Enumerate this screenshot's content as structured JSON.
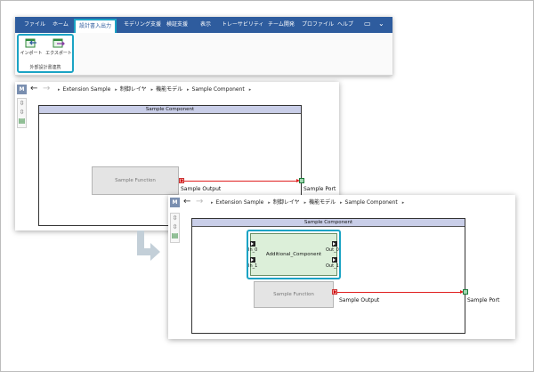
{
  "ribbon": {
    "tabs": [
      "ファイル",
      "ホーム",
      "設計書入出力",
      "モデリング支援",
      "検証支援",
      "表示",
      "トレーサビリティ",
      "チーム開発",
      "プロファイル",
      "ヘルプ"
    ],
    "active_tab_index": 2,
    "group": {
      "buttons": [
        {
          "label": "インポート",
          "icon": "import-icon"
        },
        {
          "label": "エクスポート",
          "icon": "export-icon"
        }
      ],
      "group_label": "外部設計書連携"
    },
    "window_controls": [
      "▭",
      "⌄"
    ]
  },
  "editor1": {
    "badge": "M",
    "back_icon": "←",
    "forward_icon": "→",
    "breadcrumb": [
      "Extension Sample",
      "制御レイヤ",
      "機能モデル",
      "Sample Component"
    ],
    "component_title": "Sample Component",
    "function_label": "Sample Function",
    "output_label": "Sample Output",
    "port_label": "Sample Port"
  },
  "editor2": {
    "badge": "M",
    "back_icon": "←",
    "forward_icon": "→",
    "breadcrumb": [
      "Extension Sample",
      "制御レイヤ",
      "機能モデル",
      "Sample Component"
    ],
    "component_title": "Sample Component",
    "additional_component_label": "Additional_Component",
    "ports": {
      "in0": "In_0",
      "in1": "In_1",
      "out0": "Out_0",
      "out1": "Out_1"
    },
    "function_label": "Sample Function",
    "output_label": "Sample Output",
    "port_label": "Sample Port"
  },
  "colors": {
    "ribbon_blue": "#2e5c9e",
    "highlight": "#1aa3c4",
    "wire_red": "#e02020",
    "component_title_bg": "#c9cee8",
    "additional_green": "#dcefd9",
    "arrow_gray": "#c3cfd8"
  }
}
